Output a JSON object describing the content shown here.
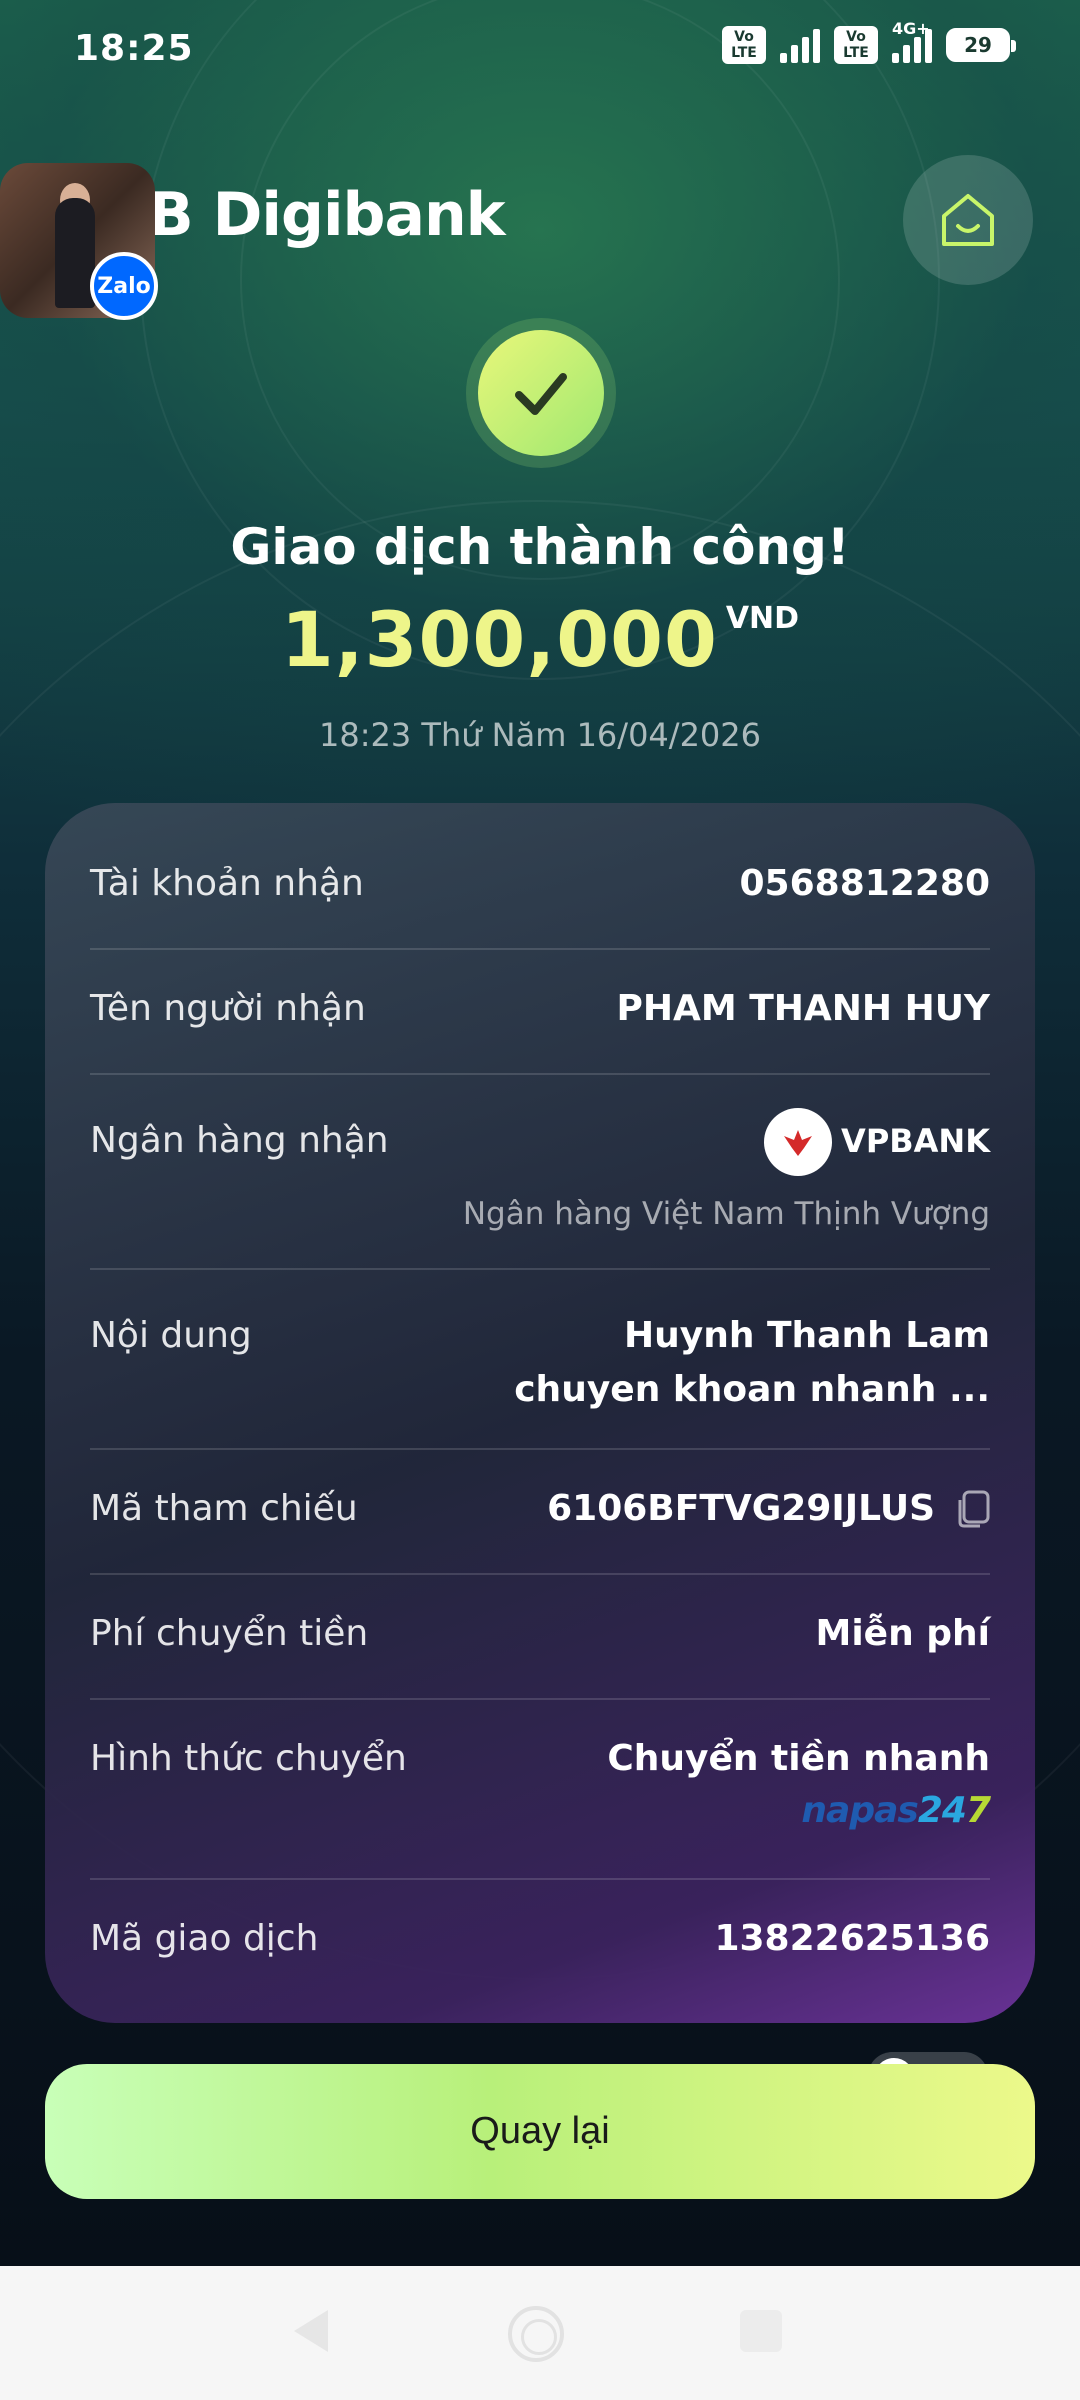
{
  "status_bar": {
    "time": "18:25",
    "lte1": "Vo LTE",
    "lte2": "Vo LTE",
    "network": "4G+",
    "battery": "29"
  },
  "header": {
    "brand": "B Digibank",
    "overlay_badge": "Zalo",
    "home_icon": "home-smile-icon"
  },
  "result": {
    "title": "Giao dịch thành công!",
    "amount": "1,300,000",
    "currency": "VND",
    "datetime": "18:23 Thứ Năm 16/04/2026"
  },
  "details": {
    "account_label": "Tài khoản nhận",
    "account_value": "0568812280",
    "recipient_label": "Tên người nhận",
    "recipient_value": "PHAM THANH HUY",
    "bank_label": "Ngân hàng nhận",
    "bank_short": "VPBANK",
    "bank_full": "Ngân hàng Việt Nam Thịnh Vượng",
    "content_label": "Nội dung",
    "content_line1": "Huynh Thanh Lam",
    "content_line2": "chuyen khoan nhanh ...",
    "reference_label": "Mã tham chiếu",
    "reference_value": "6106BFTVG29IJLUS",
    "fee_label": "Phí chuyển tiền",
    "fee_value": "Miễn phí",
    "method_label": "Hình thức chuyển",
    "method_value": "Chuyển tiền nhanh",
    "napas_a": "napas",
    "napas_b": "24",
    "napas_c": "7",
    "txn_label": "Mã giao dịch",
    "txn_value": "13822625136"
  },
  "actions": {
    "back_label": "Quay lại"
  },
  "colors": {
    "accent_green": "#b8f07a",
    "amount_yellow": "#eef58a",
    "card_purple": "#6932a0"
  }
}
